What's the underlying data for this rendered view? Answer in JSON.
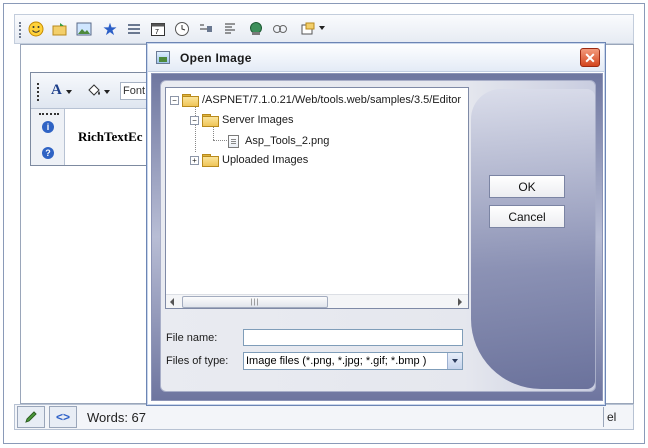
{
  "toolbar": {
    "icons": [
      "smiley-icon",
      "insert-image-folder-icon",
      "image-icon",
      "star-icon",
      "horizontal-rule-icon",
      "date-icon",
      "time-icon",
      "flash-icon",
      "paragraph-format-icon",
      "link-icon",
      "unlink-icon",
      "template-icon"
    ]
  },
  "inner_editor": {
    "font_box": "Font",
    "content_title": "RichTextEc"
  },
  "status_bar": {
    "words_label": "Words: 67",
    "right_text": "el"
  },
  "dialog": {
    "title": "Open Image",
    "tree": {
      "root_path": "/ASPNET/7.1.0.21/Web/tools.web/samples/3.5/Editor",
      "server_folder": "Server Images",
      "server_file": "Asp_Tools_2.png",
      "uploaded_folder": "Uploaded Images"
    },
    "buttons": {
      "ok": "OK",
      "cancel": "Cancel"
    },
    "file_name_label": "File name:",
    "file_name_value": "",
    "files_of_type_label": "Files of type:",
    "files_of_type_value": "Image files (*.png, *.jpg; *.gif; *.bmp )"
  }
}
